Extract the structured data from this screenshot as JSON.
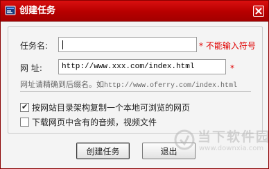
{
  "window": {
    "title": "创建任务"
  },
  "form": {
    "task_name_label": "任务名:",
    "task_name_value": "",
    "task_name_required": "* 不能输入符号",
    "url_label": "网   址:",
    "url_value": "http://www.xxx.com/index.html",
    "url_required": "*",
    "hint_prefix": "网址请精确到后缀名。如",
    "hint_example": "http://www.oferry.com/index.html"
  },
  "options": [
    {
      "label": "按网站目录架构复制一个本地可浏览的网页",
      "checked": true
    },
    {
      "label": "下载网页中含有的音频，视频文件",
      "checked": false
    }
  ],
  "buttons": {
    "create": "创建任务",
    "exit": "退出"
  },
  "watermark": {
    "text": "当下软件园",
    "url": "www.downxia.com"
  },
  "colors": {
    "title_bar": "#b70000",
    "required": "#e00000"
  }
}
